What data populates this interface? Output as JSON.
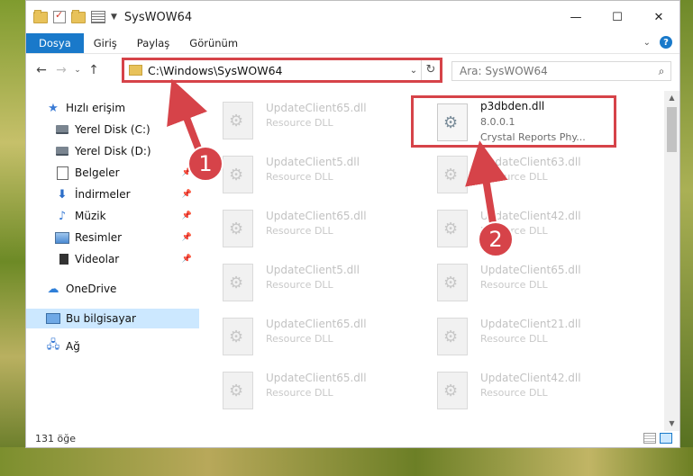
{
  "window": {
    "title": "SysWOW64"
  },
  "titlebar": {
    "minimize": "—",
    "maximize": "☐",
    "close": "✕"
  },
  "ribbon": {
    "tabs": [
      "Dosya",
      "Giriş",
      "Paylaş",
      "Görünüm"
    ],
    "help": "?",
    "expand": "⌄"
  },
  "nav": {
    "back": "←",
    "forward": "→",
    "recent": "⌄",
    "up": "↑",
    "address": "C:\\Windows\\SysWOW64",
    "address_dropdown": "⌄",
    "refresh": "↻",
    "search_placeholder": "Ara: SysWOW64",
    "search_icon": "⌕"
  },
  "sidebar": {
    "items": [
      {
        "label": "Hızlı erişim",
        "icon": "star-icon"
      },
      {
        "label": "Yerel Disk (C:)",
        "icon": "drive-icon"
      },
      {
        "label": "Yerel Disk (D:)",
        "icon": "drive-icon"
      },
      {
        "label": "Belgeler",
        "icon": "documents-icon",
        "pinned": true
      },
      {
        "label": "İndirmeler",
        "icon": "download-icon",
        "pinned": true
      },
      {
        "label": "Müzik",
        "icon": "music-icon",
        "pinned": true
      },
      {
        "label": "Resimler",
        "icon": "pictures-icon",
        "pinned": true
      },
      {
        "label": "Videolar",
        "icon": "videos-icon",
        "pinned": true
      },
      {
        "label": "OneDrive",
        "icon": "cloud-icon"
      },
      {
        "label": "Bu bilgisayar",
        "icon": "computer-icon",
        "selected": true
      },
      {
        "label": "Ağ",
        "icon": "network-icon"
      }
    ]
  },
  "files": {
    "highlighted": {
      "name": "p3dbden.dll",
      "version": "8.0.0.1",
      "description": "Crystal Reports Phy..."
    },
    "left_column": [
      {
        "name": "UpdateClient65.dll",
        "description": "Resource DLL"
      },
      {
        "name": "UpdateClient5.dll",
        "description": "Resource DLL"
      },
      {
        "name": "UpdateClient65.dll",
        "description": "Resource DLL"
      },
      {
        "name": "UpdateClient5.dll",
        "description": "Resource DLL"
      },
      {
        "name": "UpdateClient65.dll",
        "description": "Resource DLL"
      },
      {
        "name": "UpdateClient65.dll",
        "description": "Resource DLL"
      }
    ],
    "right_column": [
      {
        "name": "UpdateClient63.dll",
        "description": "Resource DLL"
      },
      {
        "name": "UpdateClient42.dll",
        "description": "Resource DLL"
      },
      {
        "name": "UpdateClient65.dll",
        "description": "Resource DLL"
      },
      {
        "name": "UpdateClient21.dll",
        "description": "Resource DLL"
      },
      {
        "name": "UpdateClient42.dll",
        "description": "Resource DLL"
      }
    ]
  },
  "status": {
    "count": "131 öğe"
  },
  "callouts": [
    "1",
    "2"
  ],
  "colors": {
    "accent": "#1979ca",
    "highlight_red": "#d64349",
    "selected_bg": "#cce8ff"
  }
}
